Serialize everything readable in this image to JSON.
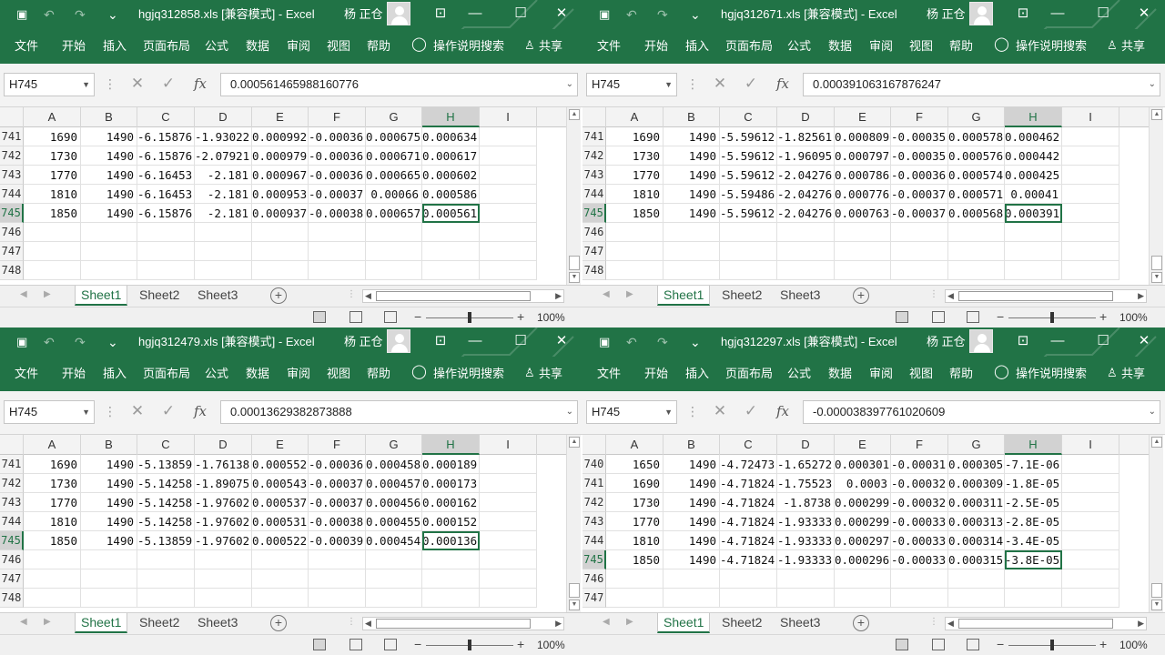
{
  "common": {
    "user": "杨 正仓",
    "menu": [
      "文件",
      "开始",
      "插入",
      "页面布局",
      "公式",
      "数据",
      "审阅",
      "视图",
      "帮助",
      "操作说明搜索",
      "共享"
    ],
    "columns": [
      "A",
      "B",
      "C",
      "D",
      "E",
      "F",
      "G",
      "H",
      "I"
    ],
    "tabs": [
      "Sheet1",
      "Sheet2",
      "Sheet3"
    ],
    "zoom": "100%",
    "name_box": "H745",
    "fx": "fx"
  },
  "windows": [
    {
      "title": "hgjq312858.xls  [兼容模式]  -  Excel",
      "formula": "0.000561465988160776",
      "rows": [
        {
          "n": "741",
          "v": [
            "1690",
            "1490",
            "-6.15876",
            "-1.93022",
            "0.000992",
            "-0.00036",
            "0.000675",
            "0.000634"
          ]
        },
        {
          "n": "742",
          "v": [
            "1730",
            "1490",
            "-6.15876",
            "-2.07921",
            "0.000979",
            "-0.00036",
            "0.000671",
            "0.000617"
          ]
        },
        {
          "n": "743",
          "v": [
            "1770",
            "1490",
            "-6.16453",
            "-2.181",
            "0.000967",
            "-0.00036",
            "0.000665",
            "0.000602"
          ]
        },
        {
          "n": "744",
          "v": [
            "1810",
            "1490",
            "-6.16453",
            "-2.181",
            "0.000953",
            "-0.00037",
            "0.00066",
            "0.000586"
          ]
        },
        {
          "n": "745",
          "v": [
            "1850",
            "1490",
            "-6.15876",
            "-2.181",
            "0.000937",
            "-0.00038",
            "0.000657",
            "0.000561"
          ]
        },
        {
          "n": "746",
          "v": []
        },
        {
          "n": "747",
          "v": []
        },
        {
          "n": "748",
          "v": []
        }
      ],
      "active_row": 4
    },
    {
      "title": "hgjq312671.xls  [兼容模式]  -  Excel",
      "formula": "0.000391063167876247",
      "rows": [
        {
          "n": "741",
          "v": [
            "1690",
            "1490",
            "-5.59612",
            "-1.82561",
            "0.000809",
            "-0.00035",
            "0.000578",
            "0.000462"
          ]
        },
        {
          "n": "742",
          "v": [
            "1730",
            "1490",
            "-5.59612",
            "-1.96095",
            "0.000797",
            "-0.00035",
            "0.000576",
            "0.000442"
          ]
        },
        {
          "n": "743",
          "v": [
            "1770",
            "1490",
            "-5.59612",
            "-2.04276",
            "0.000786",
            "-0.00036",
            "0.000574",
            "0.000425"
          ]
        },
        {
          "n": "744",
          "v": [
            "1810",
            "1490",
            "-5.59486",
            "-2.04276",
            "0.000776",
            "-0.00037",
            "0.000571",
            "0.00041"
          ]
        },
        {
          "n": "745",
          "v": [
            "1850",
            "1490",
            "-5.59612",
            "-2.04276",
            "0.000763",
            "-0.00037",
            "0.000568",
            "0.000391"
          ]
        },
        {
          "n": "746",
          "v": []
        },
        {
          "n": "747",
          "v": []
        },
        {
          "n": "748",
          "v": []
        }
      ],
      "active_row": 4
    },
    {
      "title": "hgjq312479.xls  [兼容模式]  -  Excel",
      "formula": "0.00013629382873888",
      "rows": [
        {
          "n": "741",
          "v": [
            "1690",
            "1490",
            "-5.13859",
            "-1.76138",
            "0.000552",
            "-0.00036",
            "0.000458",
            "0.000189"
          ]
        },
        {
          "n": "742",
          "v": [
            "1730",
            "1490",
            "-5.14258",
            "-1.89075",
            "0.000543",
            "-0.00037",
            "0.000457",
            "0.000173"
          ]
        },
        {
          "n": "743",
          "v": [
            "1770",
            "1490",
            "-5.14258",
            "-1.97602",
            "0.000537",
            "-0.00037",
            "0.000456",
            "0.000162"
          ]
        },
        {
          "n": "744",
          "v": [
            "1810",
            "1490",
            "-5.14258",
            "-1.97602",
            "0.000531",
            "-0.00038",
            "0.000455",
            "0.000152"
          ]
        },
        {
          "n": "745",
          "v": [
            "1850",
            "1490",
            "-5.13859",
            "-1.97602",
            "0.000522",
            "-0.00039",
            "0.000454",
            "0.000136"
          ]
        },
        {
          "n": "746",
          "v": []
        },
        {
          "n": "747",
          "v": []
        },
        {
          "n": "748",
          "v": []
        }
      ],
      "active_row": 4
    },
    {
      "title": "hgjq312297.xls  [兼容模式]  -  Excel",
      "formula": "-0.000038397761020609",
      "rows": [
        {
          "n": "740",
          "v": [
            "1650",
            "1490",
            "-4.72473",
            "-1.65272",
            "0.000301",
            "-0.00031",
            "0.000305",
            "-7.1E-06"
          ]
        },
        {
          "n": "741",
          "v": [
            "1690",
            "1490",
            "-4.71824",
            "-1.75523",
            "0.0003",
            "-0.00032",
            "0.000309",
            "-1.8E-05"
          ]
        },
        {
          "n": "742",
          "v": [
            "1730",
            "1490",
            "-4.71824",
            "-1.8738",
            "0.000299",
            "-0.00032",
            "0.000311",
            "-2.5E-05"
          ]
        },
        {
          "n": "743",
          "v": [
            "1770",
            "1490",
            "-4.71824",
            "-1.93333",
            "0.000299",
            "-0.00033",
            "0.000313",
            "-2.8E-05"
          ]
        },
        {
          "n": "744",
          "v": [
            "1810",
            "1490",
            "-4.71824",
            "-1.93333",
            "0.000297",
            "-0.00033",
            "0.000314",
            "-3.4E-05"
          ]
        },
        {
          "n": "745",
          "v": [
            "1850",
            "1490",
            "-4.71824",
            "-1.93333",
            "0.000296",
            "-0.00033",
            "0.000315",
            "-3.8E-05"
          ]
        },
        {
          "n": "746",
          "v": []
        },
        {
          "n": "747",
          "v": []
        }
      ],
      "active_row": 5
    }
  ]
}
